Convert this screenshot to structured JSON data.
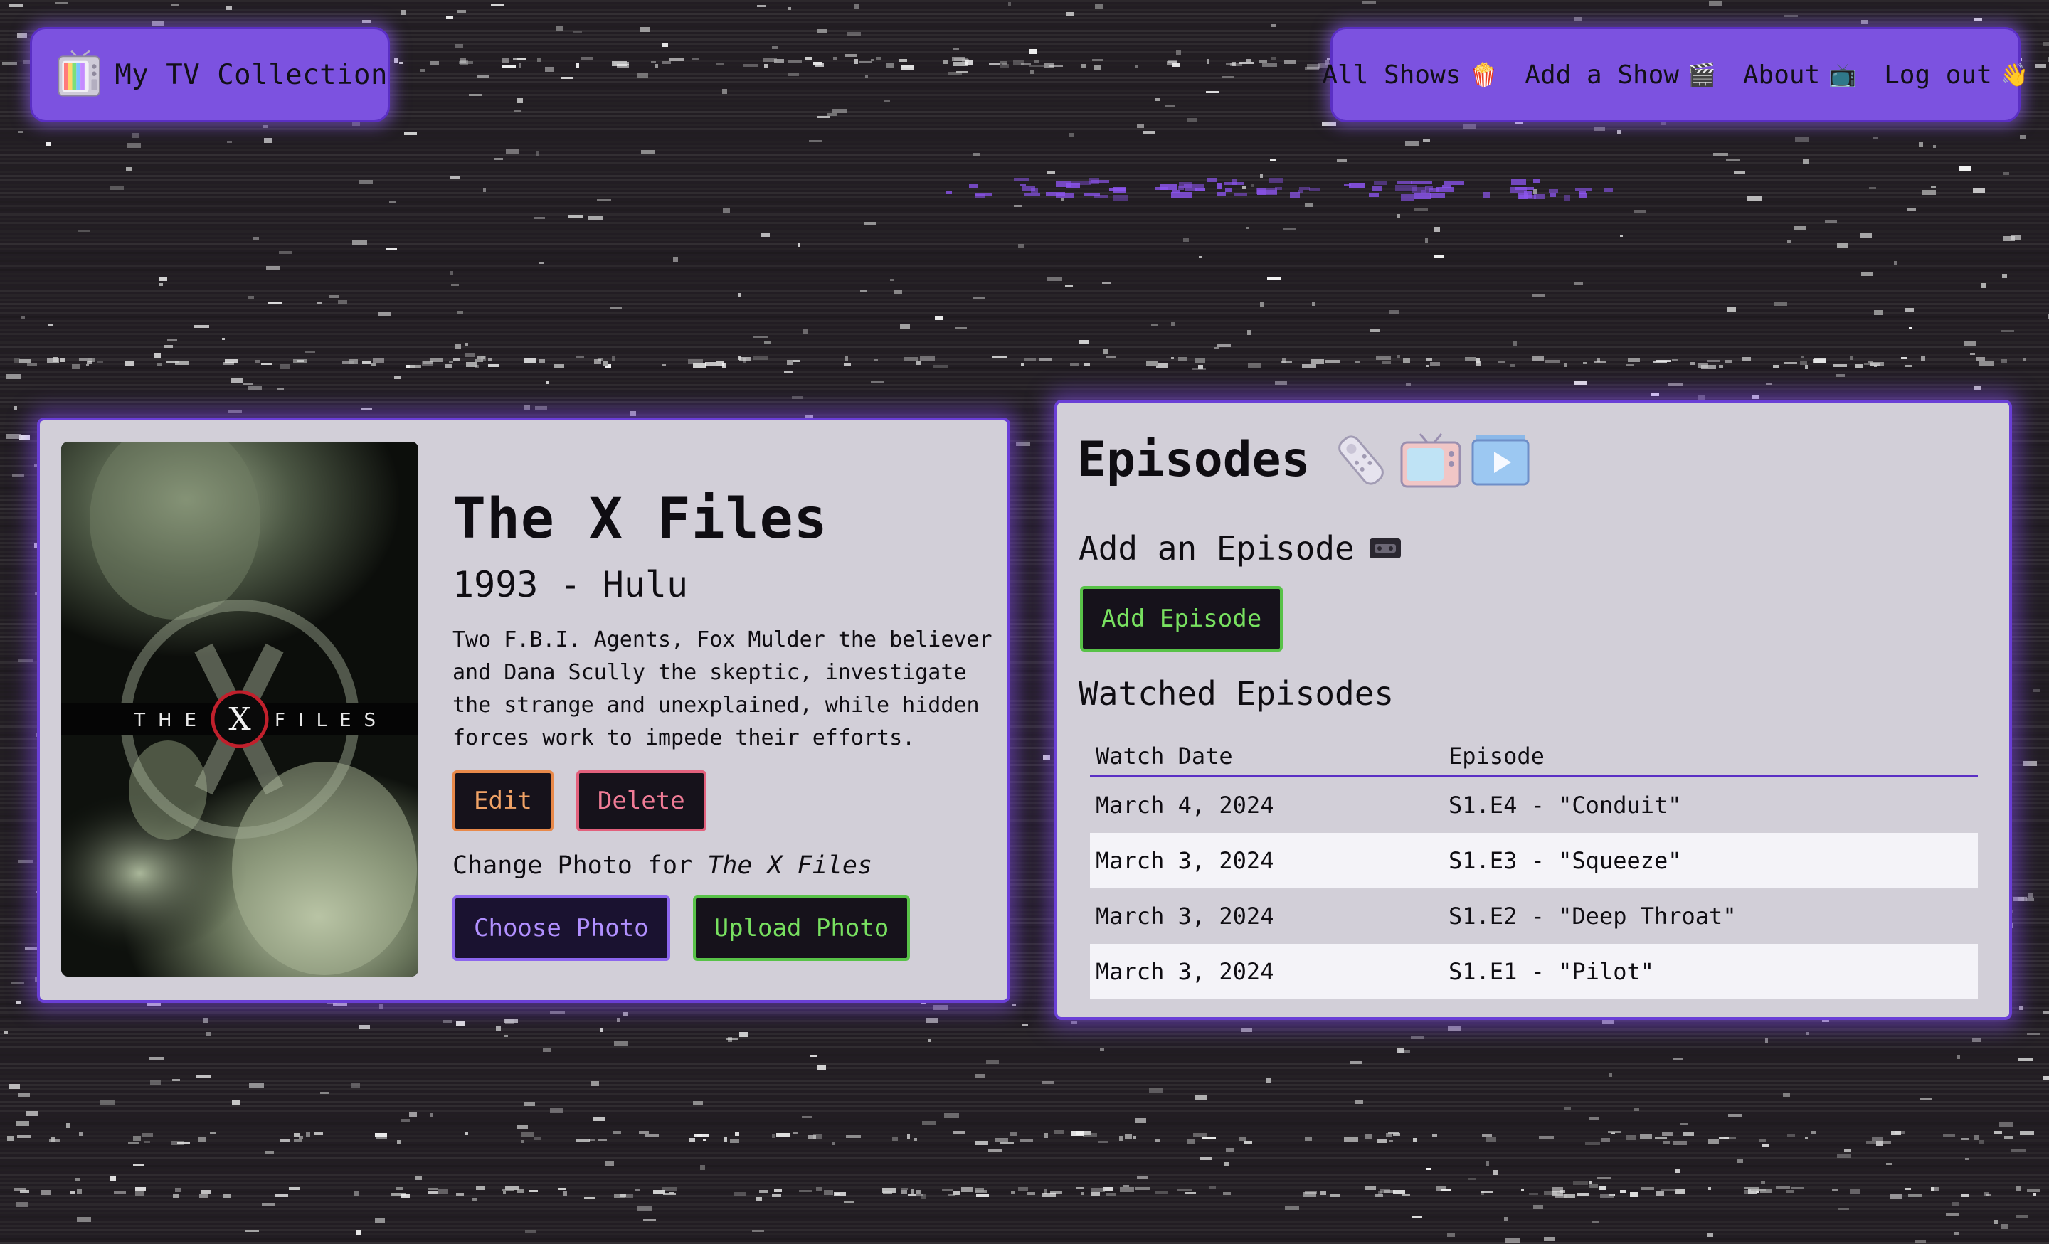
{
  "header": {
    "brand_title": "My TV Collection",
    "brand_icon": "retro-tv-icon",
    "nav": [
      {
        "label": "All Shows",
        "emoji": "🍿"
      },
      {
        "label": "Add a Show",
        "emoji": "🎬"
      },
      {
        "label": "About",
        "emoji": "📺"
      },
      {
        "label": "Log out",
        "emoji": "👋"
      }
    ]
  },
  "show": {
    "title": "The X Files",
    "meta": "1993 - Hulu",
    "description": "Two F.B.I. Agents, Fox Mulder the believer and Dana Scully the skeptic, investigate the strange and unexplained, while hidden forces work to impede their efforts.",
    "edit_label": "Edit",
    "delete_label": "Delete",
    "change_photo_prefix": "Change Photo for",
    "change_photo_show": "The X Files",
    "choose_photo_label": "Choose Photo",
    "upload_photo_label": "Upload Photo",
    "poster_text": {
      "left": "THE",
      "mark": "X",
      "right": "FILES"
    }
  },
  "episodes": {
    "title": "Episodes",
    "title_icons": [
      "remote-icon",
      "tv-icon",
      "play-icon"
    ],
    "add_label": "Add an Episode",
    "add_icon": "vhs-tape-icon",
    "add_button": "Add Episode",
    "watched_label": "Watched Episodes",
    "columns": [
      "Watch Date",
      "Episode"
    ],
    "rows": [
      {
        "date": "March 4, 2024",
        "episode": "S1.E4 - \"Conduit\""
      },
      {
        "date": "March 3, 2024",
        "episode": "S1.E3 - \"Squeeze\""
      },
      {
        "date": "March 3, 2024",
        "episode": "S1.E2 - \"Deep Throat\""
      },
      {
        "date": "March 3, 2024",
        "episode": "S1.E1 - \"Pilot\""
      }
    ]
  },
  "colors": {
    "header_bg": "#7c52e0",
    "panel_bg": "#d2cfd8",
    "panel_border": "#6a3fd6",
    "edit_accent": "#e8894a",
    "delete_accent": "#e2607c",
    "upload_accent": "#58c248",
    "choose_accent": "#8c66ee"
  }
}
